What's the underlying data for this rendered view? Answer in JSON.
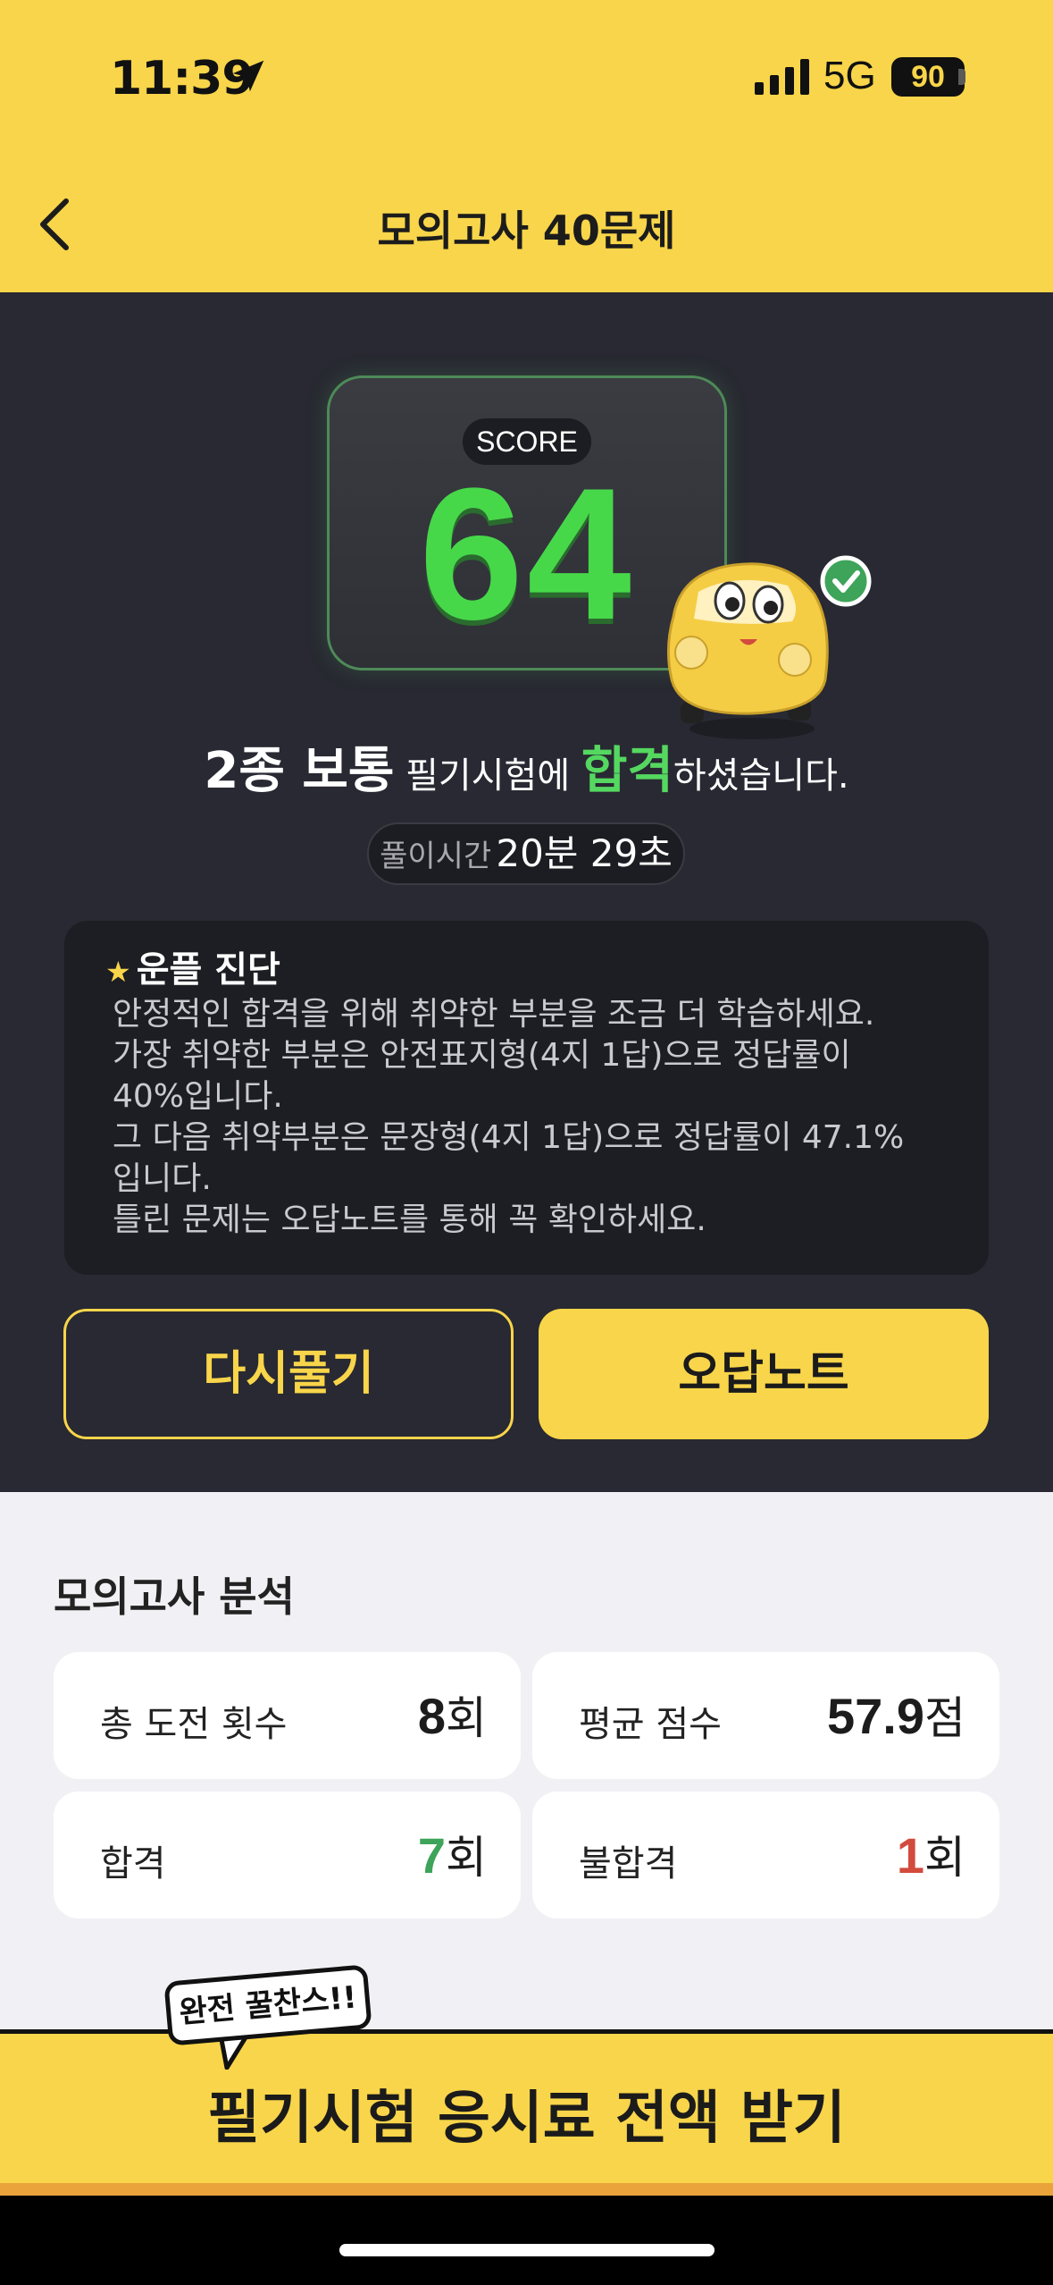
{
  "status_bar": {
    "time": "11:39",
    "network": "5G",
    "battery": "90"
  },
  "header": {
    "title": "모의고사 40문제",
    "back_icon": "chevron-left-icon"
  },
  "result": {
    "score_label": "SCORE",
    "score": "64",
    "license_type": "2종 보통",
    "sentence_mid": " 필기시험에 ",
    "pass_word": "합격",
    "sentence_end": "하셨습니다.",
    "time_label": "풀이시간",
    "time_value": "20분 29초"
  },
  "diagnosis": {
    "title": "운플 진단",
    "lines": [
      "안정적인 합격을 위해 취약한 부분을 조금 더 학습하세요.",
      "가장 취약한 부분은 안전표지형(4지 1답)으로 정답률이",
      "40%입니다.",
      "그 다음 취약부분은 문장형(4지 1답)으로 정답률이 47.1%",
      "입니다.",
      "틀린 문제는 오답노트를 통해 꼭 확인하세요."
    ]
  },
  "actions": {
    "retry": "다시풀기",
    "wrong_note": "오답노트"
  },
  "analysis": {
    "title": "모의고사 분석",
    "stats": [
      {
        "label": "총 도전 횟수",
        "value": "8",
        "unit": "회"
      },
      {
        "label": "평균 점수",
        "value": "57.9",
        "unit": "점"
      },
      {
        "label": "합격",
        "value": "7",
        "unit": "회"
      },
      {
        "label": "불합격",
        "value": "1",
        "unit": "회"
      }
    ]
  },
  "banner": {
    "badge": "완전 꿀찬스!!",
    "text": "필기시험 응시료 전액 받기"
  },
  "colors": {
    "accent_yellow": "#f8d54a",
    "dark_bg": "#282932",
    "score_green": "#47d84a",
    "pass_green": "#3da45a",
    "fail_red": "#d24b3d"
  }
}
